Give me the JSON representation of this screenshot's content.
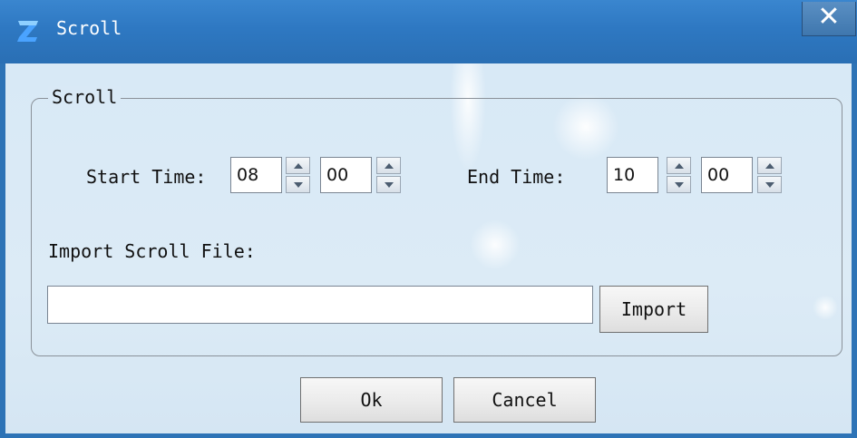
{
  "window": {
    "title": "Scroll",
    "close_label": "✕"
  },
  "group": {
    "title": "Scroll",
    "start_time": {
      "label": "Start Time:",
      "hour": "08",
      "minute": "00"
    },
    "end_time": {
      "label": "End Time:",
      "hour": "10",
      "minute": "00"
    },
    "import": {
      "label": "Import Scroll File:",
      "file_value": "",
      "button_label": "Import"
    }
  },
  "footer": {
    "ok_label": "Ok",
    "cancel_label": "Cancel"
  },
  "colors": {
    "titlebar": "#2e78c2",
    "client_bg": "#d8e9f6",
    "logo": "#4aa3ff"
  }
}
